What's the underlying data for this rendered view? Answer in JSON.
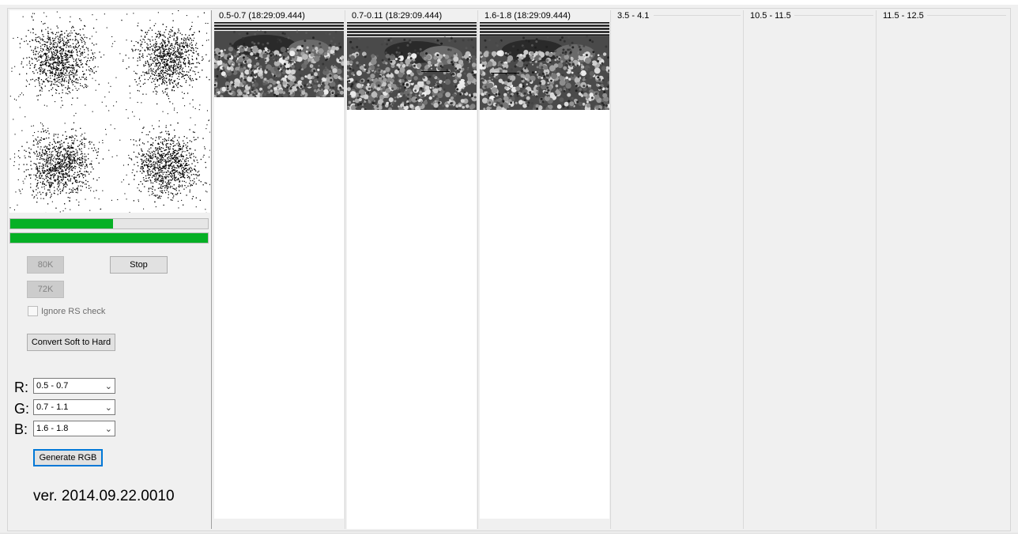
{
  "colors": {
    "progress": "#06b025",
    "default_border": "#0078d7"
  },
  "progress": {
    "bar1": 0.52,
    "bar2": 1.0
  },
  "buttons": {
    "b80k": "80K",
    "b72k": "72K",
    "stop": "Stop",
    "convert": "Convert Soft to Hard",
    "generate": "Generate RGB"
  },
  "checkbox": {
    "ignore_rs": "Ignore RS check",
    "checked": false
  },
  "channels": [
    {
      "label": "R:",
      "value": "0.5 - 0.7"
    },
    {
      "label": "G:",
      "value": "0.7 - 1.1"
    },
    {
      "label": "B:",
      "value": "1.6 - 1.8"
    }
  ],
  "version": "ver. 2014.09.22.0010",
  "panels": [
    {
      "title": "0.5-0.7 (18:29:09.444)"
    },
    {
      "title": "0.7-0.11 (18:29:09.444)"
    },
    {
      "title": "1.6-1.8 (18:29:09.444)"
    },
    {
      "title": "3.5 - 4.1"
    },
    {
      "title": "10.5 - 11.5"
    },
    {
      "title": "11.5 - 12.5"
    }
  ]
}
